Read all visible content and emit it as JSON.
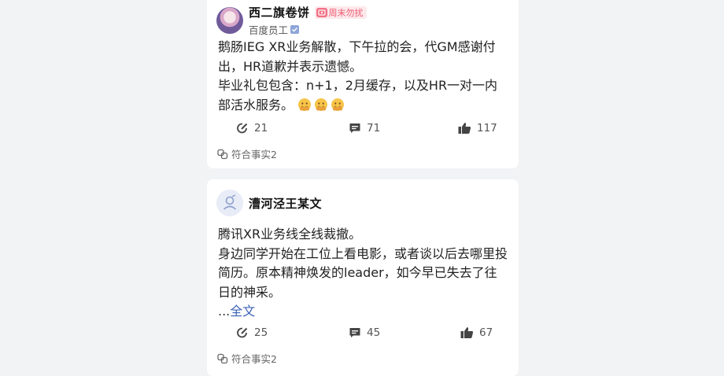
{
  "posts": [
    {
      "author": "西二旗卷饼",
      "badge": "周末勿扰",
      "subtitle": "百度员工",
      "paragraphs": [
        "鹅肠IEG XR业务解散，下午拉的会，代GM感谢付出，HR道歉并表示遗憾。",
        "毕业礼包包含：n+1，2月缓存，以及HR一对一内部活水服务。"
      ],
      "emoji_count": 3,
      "comments": "21",
      "replies": "71",
      "likes": "117",
      "fact_label": "符合事实2"
    },
    {
      "author": "漕河泾王某文",
      "paragraphs": [
        "腾讯XR业务线全线裁撤。",
        "身边同学开始在工位上看电影，或者谈以后去哪里投简历。原本精神焕发的leader，如今早已失去了往日的神采。"
      ],
      "ellipsis": "...",
      "read_more": "全文",
      "comments": "25",
      "replies": "45",
      "likes": "67",
      "fact_label": "符合事实2"
    }
  ],
  "colors": {
    "background": "#f2f3f5",
    "card": "#ffffff",
    "badge_bg": "#fde9ec",
    "badge_text": "#ef5a70",
    "link": "#3b62b5"
  },
  "icons": {
    "comment": "edit-pencil-circle-icon",
    "reply": "chat-bubble-icon",
    "like": "thumbs-up-icon",
    "fact": "link-chain-icon"
  }
}
